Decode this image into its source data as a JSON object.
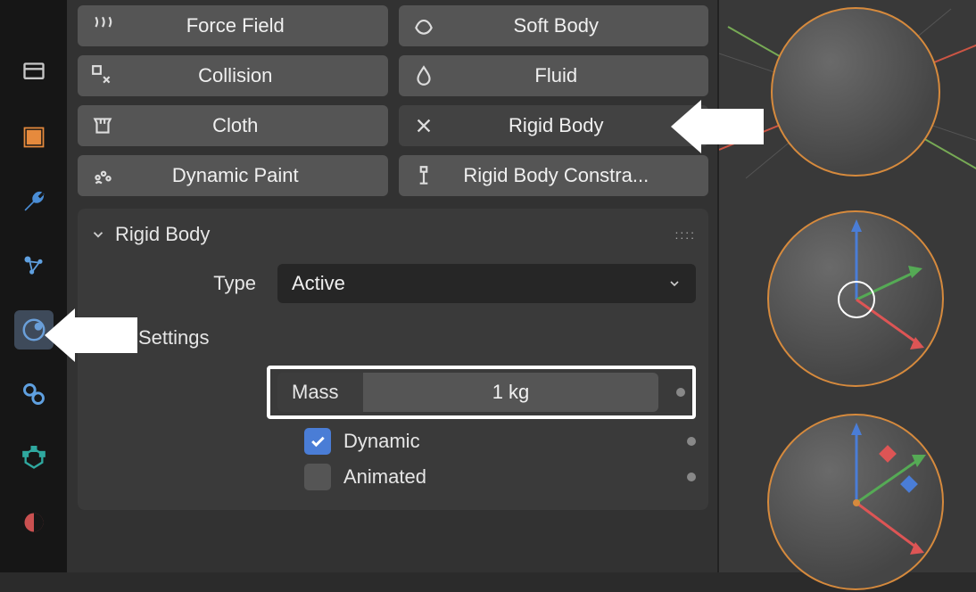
{
  "physics_buttons": {
    "force_field": "Force Field",
    "soft_body": "Soft Body",
    "collision": "Collision",
    "fluid": "Fluid",
    "cloth": "Cloth",
    "rigid_body": "Rigid Body",
    "dynamic_paint": "Dynamic Paint",
    "rigid_body_constraint": "Rigid Body Constra..."
  },
  "panel": {
    "title": "Rigid Body",
    "type_label": "Type",
    "type_value": "Active",
    "settings_label": "Settings",
    "mass": {
      "label": "Mass",
      "value": "1 kg"
    },
    "dynamic": {
      "label": "Dynamic",
      "checked": true
    },
    "animated": {
      "label": "Animated",
      "checked": false
    }
  },
  "rail_icons": [
    "output-icon",
    "object-icon",
    "modifier-icon",
    "particles-icon",
    "physics-icon",
    "constraint-icon",
    "mesh-icon",
    "material-icon"
  ],
  "viewport_objects": [
    "sphere-1",
    "sphere-2",
    "sphere-3"
  ]
}
